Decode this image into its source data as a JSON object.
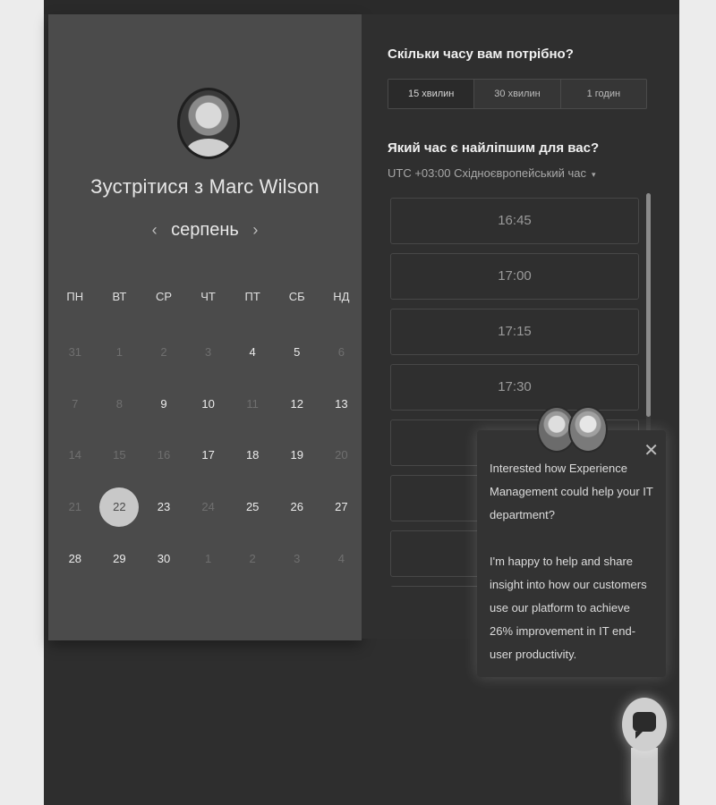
{
  "meeting": {
    "title": "Зустрітися з Marc Wilson",
    "month": "серпень",
    "prev_icon": "‹",
    "next_icon": "›"
  },
  "calendar": {
    "weekdays": [
      "ПН",
      "ВТ",
      "СР",
      "ЧТ",
      "ПТ",
      "СБ",
      "НД"
    ],
    "weeks": [
      [
        {
          "d": "31",
          "s": "muted"
        },
        {
          "d": "1",
          "s": "muted"
        },
        {
          "d": "2",
          "s": "muted"
        },
        {
          "d": "3",
          "s": "muted"
        },
        {
          "d": "4",
          "s": "active"
        },
        {
          "d": "5",
          "s": "active"
        },
        {
          "d": "6",
          "s": "muted"
        }
      ],
      [
        {
          "d": "7",
          "s": "muted"
        },
        {
          "d": "8",
          "s": "muted"
        },
        {
          "d": "9",
          "s": "active"
        },
        {
          "d": "10",
          "s": "active"
        },
        {
          "d": "11",
          "s": "muted"
        },
        {
          "d": "12",
          "s": "active"
        },
        {
          "d": "13",
          "s": "active"
        }
      ],
      [
        {
          "d": "14",
          "s": "muted"
        },
        {
          "d": "15",
          "s": "muted"
        },
        {
          "d": "16",
          "s": "muted"
        },
        {
          "d": "17",
          "s": "active"
        },
        {
          "d": "18",
          "s": "active"
        },
        {
          "d": "19",
          "s": "active"
        },
        {
          "d": "20",
          "s": "muted"
        }
      ],
      [
        {
          "d": "21",
          "s": "muted"
        },
        {
          "d": "22",
          "s": "selected"
        },
        {
          "d": "23",
          "s": "active"
        },
        {
          "d": "24",
          "s": "muted"
        },
        {
          "d": "25",
          "s": "active"
        },
        {
          "d": "26",
          "s": "active"
        },
        {
          "d": "27",
          "s": "active"
        }
      ],
      [
        {
          "d": "28",
          "s": "active"
        },
        {
          "d": "29",
          "s": "active"
        },
        {
          "d": "30",
          "s": "active"
        },
        {
          "d": "1",
          "s": "muted"
        },
        {
          "d": "2",
          "s": "muted"
        },
        {
          "d": "3",
          "s": "muted"
        },
        {
          "d": "4",
          "s": "muted"
        }
      ]
    ]
  },
  "duration": {
    "question": "Скільки часу вам потрібно?",
    "options": [
      "15 хвилин",
      "30 хвилин",
      "1 годин"
    ],
    "selected_index": 0
  },
  "time": {
    "question": "Який час є найліпшим для вас?",
    "timezone": "UTC +03:00 Східноєвропейський час",
    "timezone_caret": "▾",
    "slots": [
      "16:45",
      "17:00",
      "17:15",
      "17:30",
      "",
      "",
      "",
      ""
    ]
  },
  "chat": {
    "close_icon": "✕",
    "message_1": "Interested how Experience Management could help your IT department?",
    "message_2": "I'm happy to help and share insight into how our customers use our platform to achieve 26% improvement in IT end-user productivity."
  },
  "colors": {
    "left_panel": "#4b4b4b",
    "right_panel": "#2f2f2f",
    "selected_day": "#c8c8c8"
  }
}
